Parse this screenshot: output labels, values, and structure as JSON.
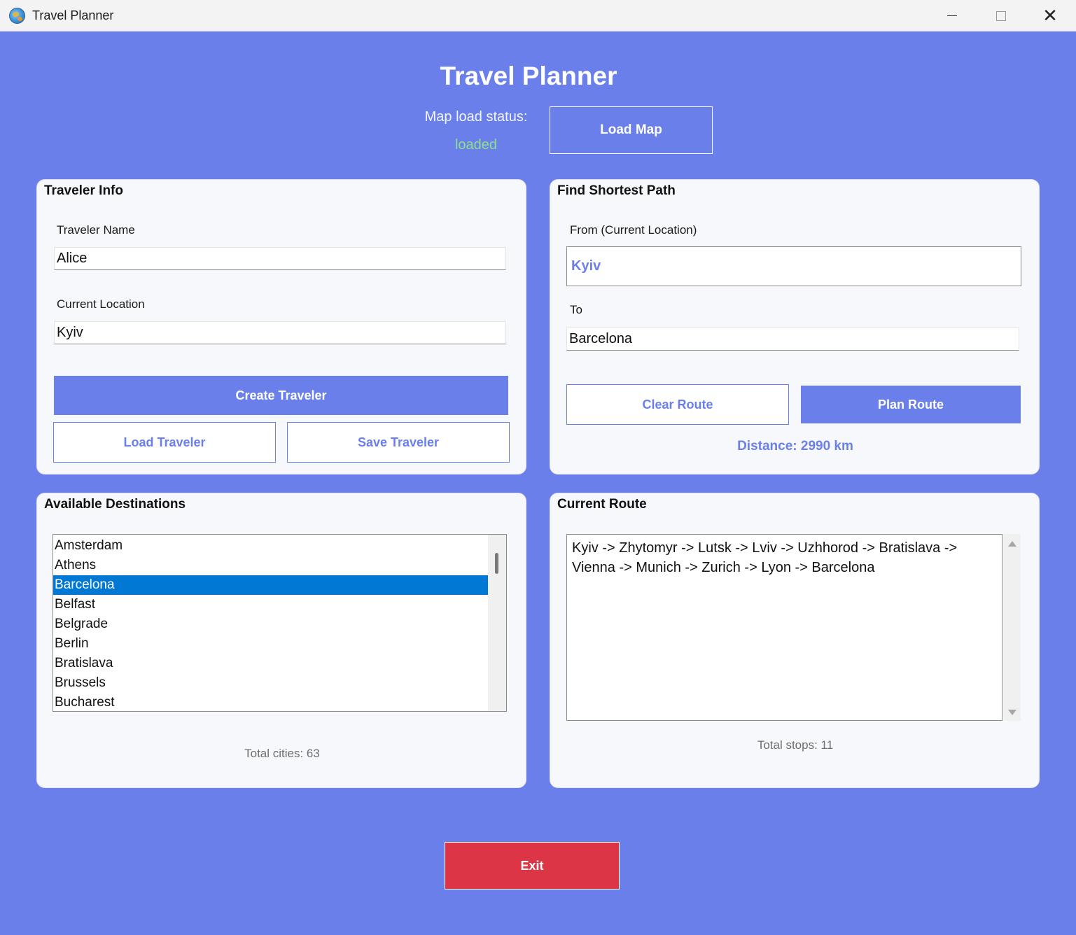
{
  "window": {
    "title": "Travel Planner",
    "minimize_icon": "minimize-icon",
    "maximize_icon": "maximize-icon",
    "close_glyph": "✕"
  },
  "header": {
    "title": "Travel Planner",
    "map_status_label": "Map load status:",
    "map_status_value": "loaded",
    "load_map_label": "Load Map"
  },
  "traveler_info": {
    "title": "Traveler Info",
    "name_label": "Traveler Name",
    "name_value": "Alice",
    "location_label": "Current Location",
    "location_value": "Kyiv",
    "create_label": "Create Traveler",
    "load_label": "Load Traveler",
    "save_label": "Save Traveler"
  },
  "shortest_path": {
    "title": "Find Shortest Path",
    "from_label": "From (Current Location)",
    "from_value": "Kyiv",
    "to_label": "To",
    "to_value": "Barcelona",
    "clear_label": "Clear Route",
    "plan_label": "Plan Route",
    "distance_text": "Distance: 2990 km"
  },
  "destinations": {
    "title": "Available Destinations",
    "items": [
      "Amsterdam",
      "Athens",
      "Barcelona",
      "Belfast",
      "Belgrade",
      "Berlin",
      "Bratislava",
      "Brussels",
      "Bucharest"
    ],
    "selected": "Barcelona",
    "total_text": "Total cities: 63"
  },
  "current_route": {
    "title": "Current Route",
    "route_text": "Kyiv -> Zhytomyr -> Lutsk -> Lviv -> Uzhhorod -> Bratislava -> Vienna -> Munich -> Zurich -> Lyon -> Barcelona",
    "total_text": "Total stops: 11"
  },
  "footer": {
    "exit_label": "Exit"
  },
  "colors": {
    "background": "#6a7fe9",
    "accent": "#6a7fe9",
    "status_ok": "#8ee08f",
    "selection": "#0078d4",
    "exit": "#dc3545"
  }
}
